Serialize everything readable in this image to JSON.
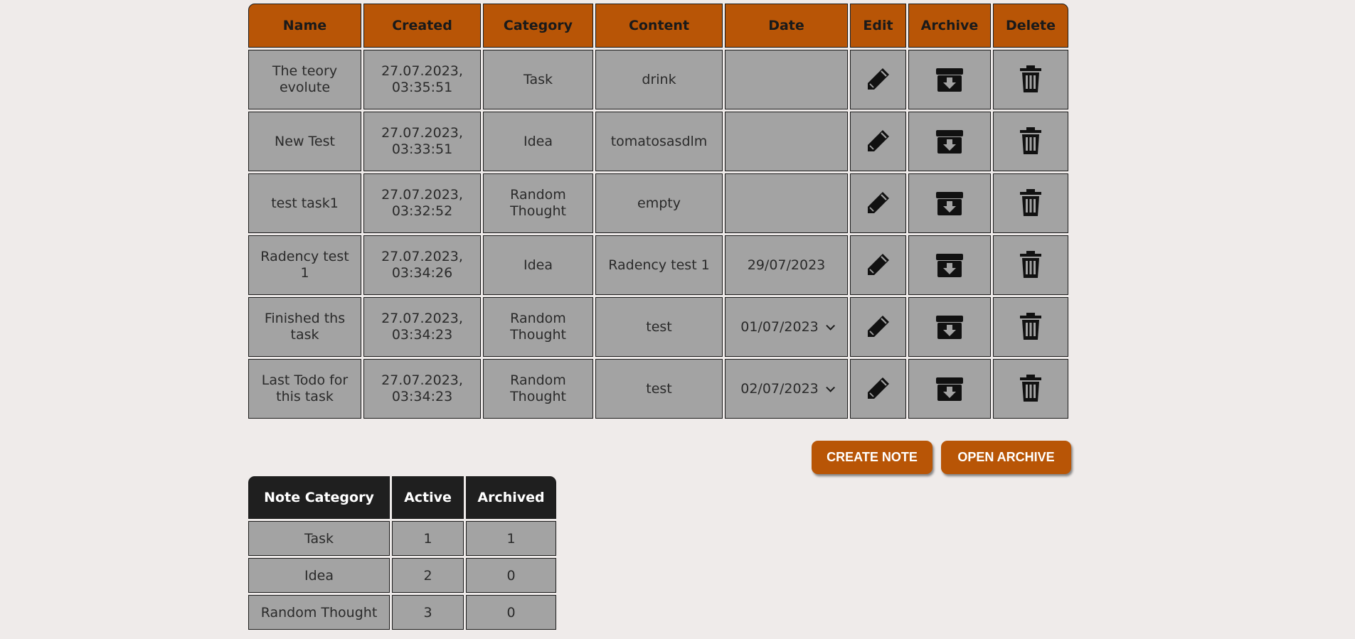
{
  "notes_table": {
    "headers": [
      "Name",
      "Created",
      "Category",
      "Content",
      "Date",
      "Edit",
      "Archive",
      "Delete"
    ],
    "rows": [
      {
        "name": "The teory evolute",
        "created": "27.07.2023, 03:35:51",
        "category": "Task",
        "content": "drink",
        "date": "",
        "date_is_select": false
      },
      {
        "name": "New Test",
        "created": "27.07.2023, 03:33:51",
        "category": "Idea",
        "content": "tomatosasdlm",
        "date": "",
        "date_is_select": false
      },
      {
        "name": "test task1",
        "created": "27.07.2023, 03:32:52",
        "category": "Random Thought",
        "content": "empty",
        "date": "",
        "date_is_select": false
      },
      {
        "name": "Radency test 1",
        "created": "27.07.2023, 03:34:26",
        "category": "Idea",
        "content": "Radency test 1",
        "date": "29/07/2023",
        "date_is_select": false
      },
      {
        "name": "Finished ths task",
        "created": "27.07.2023, 03:34:23",
        "category": "Random Thought",
        "content": "test",
        "date": "01/07/2023",
        "date_is_select": true
      },
      {
        "name": "Last Todo for this task",
        "created": "27.07.2023, 03:34:23",
        "category": "Random Thought",
        "content": "test",
        "date": "02/07/2023",
        "date_is_select": true
      }
    ],
    "icons": {
      "edit": "pencil-icon",
      "archive": "archive-box-icon",
      "delete": "trash-icon"
    }
  },
  "actions": {
    "create_note": "CREATE NOTE",
    "open_archive": "OPEN ARCHIVE"
  },
  "summary_table": {
    "headers": [
      "Note Category",
      "Active",
      "Archived"
    ],
    "rows": [
      {
        "category": "Task",
        "active": "1",
        "archived": "1"
      },
      {
        "category": "Idea",
        "active": "2",
        "archived": "0"
      },
      {
        "category": "Random Thought",
        "active": "3",
        "archived": "0"
      }
    ]
  },
  "colors": {
    "accent": "#b85506",
    "background": "#efebea",
    "cell": "#a3a3a3",
    "summary_header": "#1f1f1f"
  }
}
